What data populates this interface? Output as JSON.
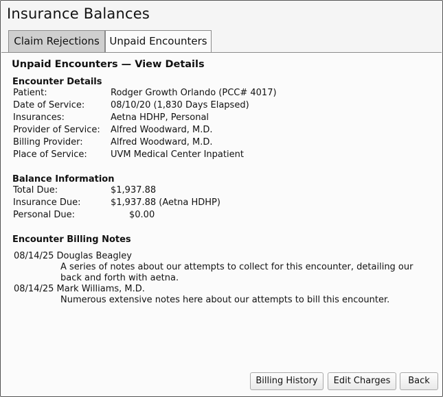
{
  "app": {
    "title": "Insurance Balances"
  },
  "tabs": [
    {
      "label": "Claim Rejections"
    },
    {
      "label": "Unpaid Encounters"
    }
  ],
  "panel": {
    "title": "Unpaid Encounters — View Details"
  },
  "encounter": {
    "heading": "Encounter Details",
    "rows": [
      {
        "label": "Patient:",
        "value": "Rodger Growth Orlando (PCC# 4017)"
      },
      {
        "label": "Date of Service:",
        "value": "08/10/20 (1,830 Days Elapsed)"
      },
      {
        "label": "Insurances:",
        "value": "Aetna HDHP, Personal"
      },
      {
        "label": "Provider of Service:",
        "value": "Alfred Woodward, M.D."
      },
      {
        "label": "Billing Provider:",
        "value": "Alfred Woodward, M.D."
      },
      {
        "label": "Place of Service:",
        "value": "UVM Medical Center Inpatient"
      }
    ]
  },
  "balance": {
    "heading": "Balance Information",
    "rows": [
      {
        "label": "Total Due:",
        "value": "$1,937.88"
      },
      {
        "label": "Insurance Due:",
        "value": "$1,937.88 (Aetna HDHP)"
      },
      {
        "label": "Personal Due:",
        "value": "$0.00"
      }
    ]
  },
  "notes": {
    "heading": "Encounter Billing Notes",
    "items": [
      {
        "header": "08/14/25 Douglas Beagley",
        "text": "A series of notes about our attempts to collect for this encounter, detailing our back and forth with aetna."
      },
      {
        "header": "08/14/25 Mark Williams, M.D.",
        "text": "Numerous extensive notes here about our attempts to bill this encounter."
      }
    ]
  },
  "buttons": {
    "billing_history": "Billing History",
    "edit_charges": "Edit Charges",
    "back": "Back"
  }
}
